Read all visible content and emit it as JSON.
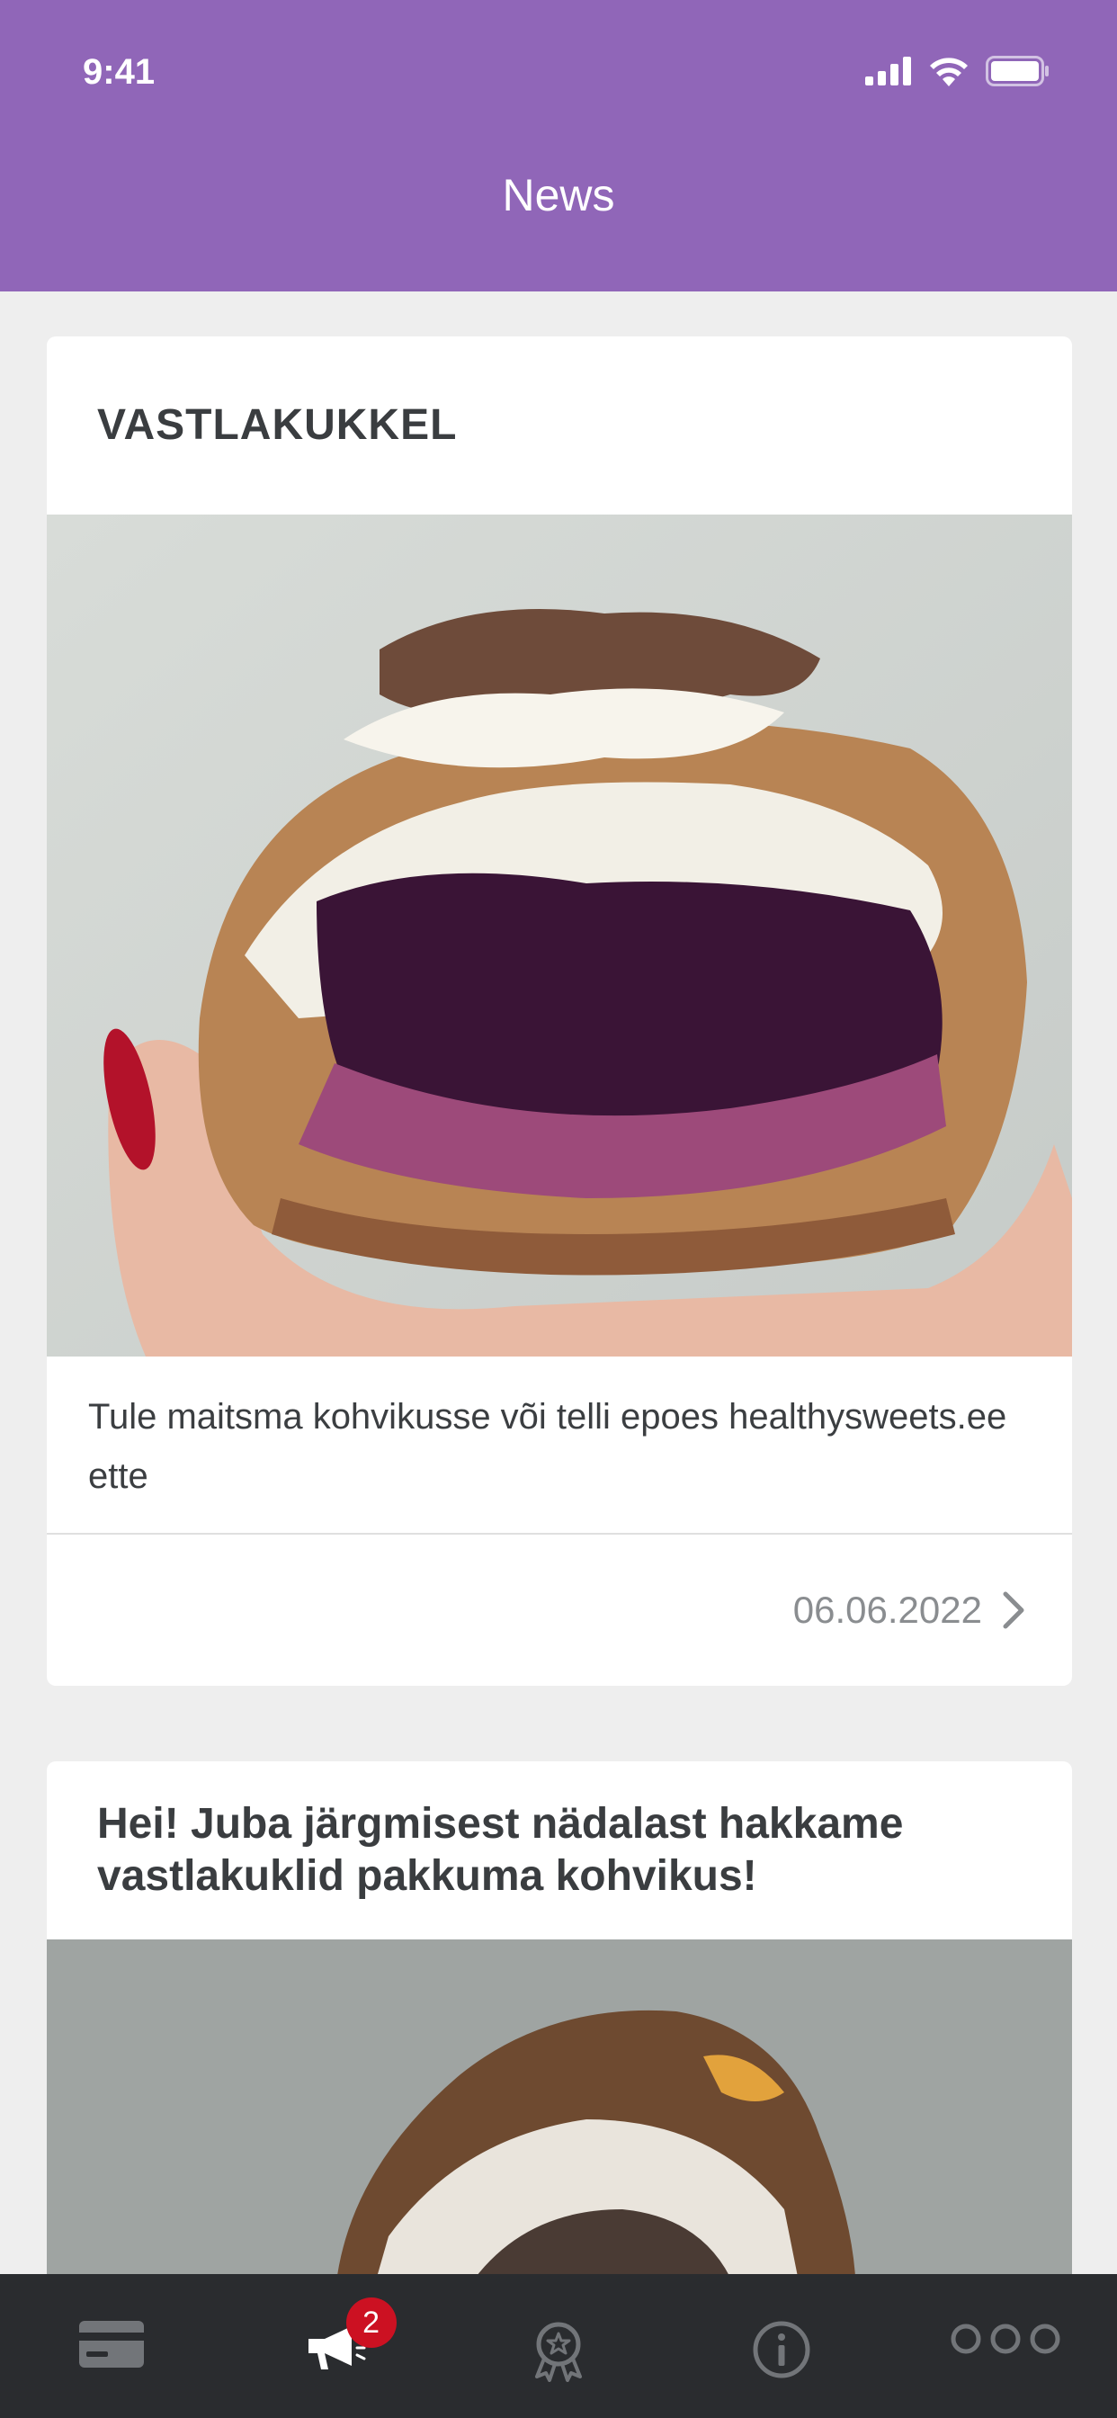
{
  "status": {
    "time": "9:41"
  },
  "header": {
    "title": "News"
  },
  "posts": [
    {
      "title": "VASTLAKUKKEL",
      "body": "Tule maitsma kohvikusse või telli epoes healthysweets.ee ette",
      "date": "06.06.2022"
    },
    {
      "title": "Hei! Juba järgmisest nädalast hakkame vastlakuklid pakkuma kohvikus!"
    }
  ],
  "tabbar": {
    "items": [
      {
        "icon": "card-icon"
      },
      {
        "icon": "megaphone-icon",
        "badge": "2"
      },
      {
        "icon": "award-icon"
      },
      {
        "icon": "info-icon"
      },
      {
        "icon": "more-icon"
      }
    ]
  },
  "colors": {
    "header": "#9066b8",
    "tabbar": "#2a2c2f",
    "badge": "#cc1122",
    "background": "#eeeeee"
  }
}
